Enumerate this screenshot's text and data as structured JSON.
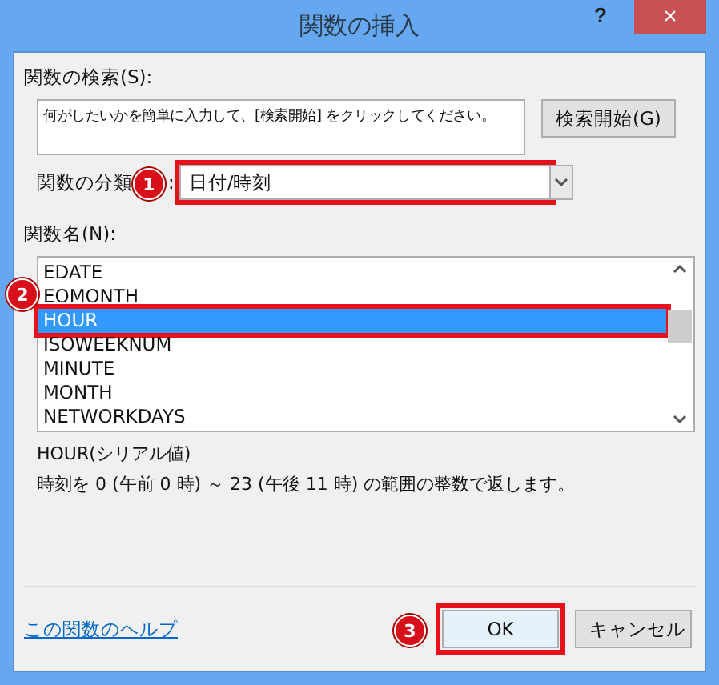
{
  "window": {
    "title": "関数の挿入",
    "help": "?",
    "close": "×"
  },
  "search": {
    "label": "関数の検索(S):",
    "value": "何がしたいかを簡単に入力して、[検索開始] をクリックしてください。",
    "button": "検索開始(G)"
  },
  "category": {
    "label": "関数の分類",
    "colon": ":",
    "value": "日付/時刻",
    "highlighted": true,
    "badge": "1"
  },
  "functions": {
    "label": "関数名(N):",
    "badge": "2",
    "items": [
      {
        "name": "EDATE",
        "selected": false,
        "highlighted": false
      },
      {
        "name": "EOMONTH",
        "selected": false,
        "highlighted": false
      },
      {
        "name": "HOUR",
        "selected": true,
        "highlighted": true
      },
      {
        "name": "ISOWEEKNUM",
        "selected": false,
        "highlighted": false
      },
      {
        "name": "MINUTE",
        "selected": false,
        "highlighted": false
      },
      {
        "name": "MONTH",
        "selected": false,
        "highlighted": false
      },
      {
        "name": "NETWORKDAYS",
        "selected": false,
        "highlighted": false
      }
    ]
  },
  "description": {
    "signature": "HOUR(シリアル値)",
    "text": "時刻を 0 (午前 0 時) ～ 23 (午後 11 時) の範囲の整数で返します。"
  },
  "help_link": "この関数のヘルプ",
  "buttons": [
    {
      "label": "OK",
      "highlighted": true,
      "badge": "3"
    },
    {
      "label": "キャンセル",
      "highlighted": false
    }
  ]
}
